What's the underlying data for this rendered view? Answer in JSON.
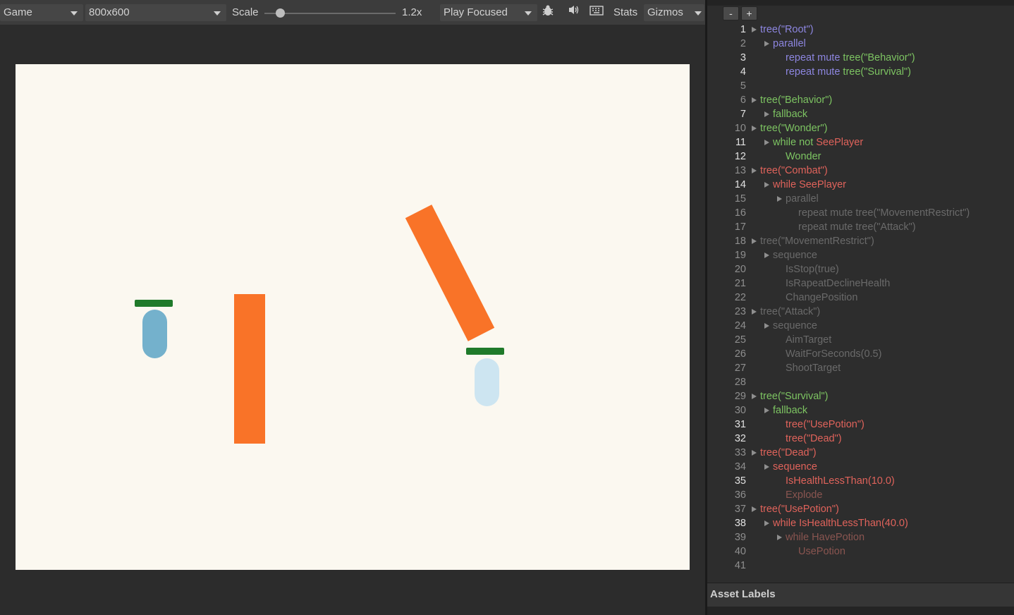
{
  "toolbar": {
    "view_label": "Game",
    "resolution": "800x600",
    "scale_label": "Scale",
    "scale_value": "1.2x",
    "scale_fraction": 0.12,
    "play_mode": "Play Focused",
    "stats_label": "Stats",
    "gizmos_label": "Gizmos",
    "icons": [
      "bug-icon",
      "speaker-icon",
      "keyboard-icon"
    ]
  },
  "scene": {
    "background_color": "#fbf8f0",
    "obstacle_color": "#f97328",
    "player_color": "#74b1cc",
    "enemy_color": "#cde5f1",
    "healthbar_color": "#1f7a2a",
    "player_health": 1.0,
    "enemy_health": 1.0
  },
  "code_panel": {
    "minus_label": "-",
    "plus_label": "+",
    "colors": {
      "purple": "#8d86e0",
      "green": "#7dc462",
      "red": "#e0635b",
      "dim": "#6a6a6a",
      "dim_red": "#8a5550"
    },
    "lines": [
      {
        "n": "1",
        "hl": true,
        "ind": 0,
        "arrow": true,
        "segs": [
          {
            "t": "tree(\"Root\")",
            "c": "purple"
          }
        ]
      },
      {
        "n": "2",
        "hl": false,
        "ind": 1,
        "arrow": true,
        "segs": [
          {
            "t": "parallel",
            "c": "purple"
          }
        ]
      },
      {
        "n": "3",
        "hl": true,
        "ind": 2,
        "arrow": false,
        "segs": [
          {
            "t": "repeat mute ",
            "c": "purple"
          },
          {
            "t": "tree(\"Behavior\")",
            "c": "green"
          }
        ]
      },
      {
        "n": "4",
        "hl": true,
        "ind": 2,
        "arrow": false,
        "segs": [
          {
            "t": "repeat mute ",
            "c": "purple"
          },
          {
            "t": "tree(\"Survival\")",
            "c": "green"
          }
        ]
      },
      {
        "n": "5",
        "hl": false,
        "ind": 0,
        "arrow": false,
        "segs": []
      },
      {
        "n": "6",
        "hl": false,
        "ind": 0,
        "arrow": true,
        "segs": [
          {
            "t": "tree(\"Behavior\")",
            "c": "green"
          }
        ]
      },
      {
        "n": "7",
        "hl": true,
        "ind": 1,
        "arrow": true,
        "segs": [
          {
            "t": "fallback",
            "c": "green"
          }
        ]
      },
      {
        "n": "10",
        "hl": false,
        "ind": 0,
        "arrow": true,
        "segs": [
          {
            "t": "tree(\"Wonder\")",
            "c": "green"
          }
        ]
      },
      {
        "n": "11",
        "hl": true,
        "ind": 1,
        "arrow": true,
        "segs": [
          {
            "t": "while not ",
            "c": "green"
          },
          {
            "t": "SeePlayer",
            "c": "red"
          }
        ]
      },
      {
        "n": "12",
        "hl": true,
        "ind": 2,
        "arrow": false,
        "segs": [
          {
            "t": "Wonder",
            "c": "green"
          }
        ]
      },
      {
        "n": "13",
        "hl": false,
        "ind": 0,
        "arrow": true,
        "segs": [
          {
            "t": "tree(\"Combat\")",
            "c": "red"
          }
        ]
      },
      {
        "n": "14",
        "hl": true,
        "ind": 1,
        "arrow": true,
        "segs": [
          {
            "t": "while SeePlayer",
            "c": "red"
          }
        ]
      },
      {
        "n": "15",
        "hl": false,
        "ind": 2,
        "arrow": true,
        "segs": [
          {
            "t": "parallel",
            "c": "dim"
          }
        ]
      },
      {
        "n": "16",
        "hl": false,
        "ind": 3,
        "arrow": false,
        "segs": [
          {
            "t": "repeat mute tree(\"MovementRestrict\")",
            "c": "dim"
          }
        ]
      },
      {
        "n": "17",
        "hl": false,
        "ind": 3,
        "arrow": false,
        "segs": [
          {
            "t": "repeat mute tree(\"Attack\")",
            "c": "dim"
          }
        ]
      },
      {
        "n": "18",
        "hl": false,
        "ind": 0,
        "arrow": true,
        "segs": [
          {
            "t": "tree(\"MovementRestrict\")",
            "c": "dim"
          }
        ]
      },
      {
        "n": "19",
        "hl": false,
        "ind": 1,
        "arrow": true,
        "segs": [
          {
            "t": "sequence",
            "c": "dim"
          }
        ]
      },
      {
        "n": "20",
        "hl": false,
        "ind": 2,
        "arrow": false,
        "segs": [
          {
            "t": "IsStop(true)",
            "c": "dim"
          }
        ]
      },
      {
        "n": "21",
        "hl": false,
        "ind": 2,
        "arrow": false,
        "segs": [
          {
            "t": "IsRapeatDeclineHealth",
            "c": "dim"
          }
        ]
      },
      {
        "n": "22",
        "hl": false,
        "ind": 2,
        "arrow": false,
        "segs": [
          {
            "t": "ChangePosition",
            "c": "dim"
          }
        ]
      },
      {
        "n": "23",
        "hl": false,
        "ind": 0,
        "arrow": true,
        "segs": [
          {
            "t": "tree(\"Attack\")",
            "c": "dim"
          }
        ]
      },
      {
        "n": "24",
        "hl": false,
        "ind": 1,
        "arrow": true,
        "segs": [
          {
            "t": "sequence",
            "c": "dim"
          }
        ]
      },
      {
        "n": "25",
        "hl": false,
        "ind": 2,
        "arrow": false,
        "segs": [
          {
            "t": "AimTarget",
            "c": "dim"
          }
        ]
      },
      {
        "n": "26",
        "hl": false,
        "ind": 2,
        "arrow": false,
        "segs": [
          {
            "t": "WaitForSeconds(0.5)",
            "c": "dim"
          }
        ]
      },
      {
        "n": "27",
        "hl": false,
        "ind": 2,
        "arrow": false,
        "segs": [
          {
            "t": "ShootTarget",
            "c": "dim"
          }
        ]
      },
      {
        "n": "28",
        "hl": false,
        "ind": 0,
        "arrow": false,
        "segs": []
      },
      {
        "n": "29",
        "hl": false,
        "ind": 0,
        "arrow": true,
        "segs": [
          {
            "t": "tree(\"Survival\")",
            "c": "green"
          }
        ]
      },
      {
        "n": "30",
        "hl": false,
        "ind": 1,
        "arrow": true,
        "segs": [
          {
            "t": "fallback",
            "c": "green"
          }
        ]
      },
      {
        "n": "31",
        "hl": true,
        "ind": 2,
        "arrow": false,
        "segs": [
          {
            "t": "tree(\"UsePotion\")",
            "c": "red"
          }
        ]
      },
      {
        "n": "32",
        "hl": true,
        "ind": 2,
        "arrow": false,
        "segs": [
          {
            "t": "tree(\"Dead\")",
            "c": "red"
          }
        ]
      },
      {
        "n": "33",
        "hl": false,
        "ind": 0,
        "arrow": true,
        "segs": [
          {
            "t": "tree(\"Dead\")",
            "c": "red"
          }
        ]
      },
      {
        "n": "34",
        "hl": false,
        "ind": 1,
        "arrow": true,
        "segs": [
          {
            "t": "sequence",
            "c": "red"
          }
        ]
      },
      {
        "n": "35",
        "hl": true,
        "ind": 2,
        "arrow": false,
        "segs": [
          {
            "t": "IsHealthLessThan(10.0)",
            "c": "red"
          }
        ]
      },
      {
        "n": "36",
        "hl": false,
        "ind": 2,
        "arrow": false,
        "segs": [
          {
            "t": "Explode",
            "c": "dim_red"
          }
        ]
      },
      {
        "n": "37",
        "hl": false,
        "ind": 0,
        "arrow": true,
        "segs": [
          {
            "t": "tree(\"UsePotion\")",
            "c": "red"
          }
        ]
      },
      {
        "n": "38",
        "hl": true,
        "ind": 1,
        "arrow": true,
        "segs": [
          {
            "t": "while IsHealthLessThan(40.0)",
            "c": "red"
          }
        ]
      },
      {
        "n": "39",
        "hl": false,
        "ind": 2,
        "arrow": true,
        "segs": [
          {
            "t": "while HavePotion",
            "c": "dim_red"
          }
        ]
      },
      {
        "n": "40",
        "hl": false,
        "ind": 3,
        "arrow": false,
        "segs": [
          {
            "t": "UsePotion",
            "c": "dim_red"
          }
        ]
      },
      {
        "n": "41",
        "hl": false,
        "ind": 0,
        "arrow": false,
        "segs": []
      }
    ]
  },
  "asset_labels": {
    "title": "Asset Labels"
  }
}
